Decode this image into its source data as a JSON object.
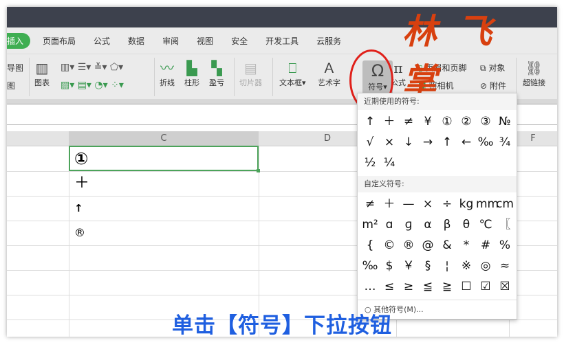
{
  "logo_text": "林飞掌",
  "tabs": [
    {
      "label": "插入",
      "active": true
    },
    {
      "label": "页面布局"
    },
    {
      "label": "公式"
    },
    {
      "label": "数据"
    },
    {
      "label": "审阅"
    },
    {
      "label": "视图"
    },
    {
      "label": "安全"
    },
    {
      "label": "开发工具"
    },
    {
      "label": "云服务"
    }
  ],
  "ribbon": {
    "partial_top": "导图",
    "partial_bottom": "图",
    "chart": "图表",
    "line": "折线",
    "column": "柱形",
    "winloss": "盈亏",
    "slicer": "切片器",
    "textbox": "文本框",
    "wordart": "艺术字",
    "symbol": "符号",
    "formula": "公式",
    "header_footer": "页眉和页脚",
    "camera": "照相机",
    "object": "对象",
    "attachment": "附件",
    "hyperlink": "超链接"
  },
  "columns": [
    "C",
    "D",
    "F"
  ],
  "cells": [
    "①",
    "＋",
    "↑",
    "®"
  ],
  "popup": {
    "recent_title": "近期使用的符号:",
    "recent": [
      "↑",
      "＋",
      "≠",
      "¥",
      "①",
      "②",
      "③",
      "№",
      "√",
      "×",
      "↓",
      "→",
      "↑",
      "←",
      "‰",
      "¾",
      "½",
      "¼"
    ],
    "custom_title": "自定义符号:",
    "custom": [
      "≠",
      "＋",
      "—",
      "×",
      "÷",
      "kg",
      "mm",
      "cm",
      "m²",
      "ɑ",
      "ɡ",
      "α",
      "β",
      "θ",
      "℃",
      "〖",
      "{",
      "©",
      "®",
      "@",
      "&",
      "*",
      "#",
      "%",
      "‰",
      "$",
      "￥",
      "§",
      "¦",
      "※",
      "◎",
      "≈",
      "…",
      "≤",
      "≥",
      "≦",
      "≧",
      "☐",
      "☑",
      "☒"
    ],
    "more": "其他符号(M)..."
  },
  "caption": "单击【符号】下拉按钮"
}
